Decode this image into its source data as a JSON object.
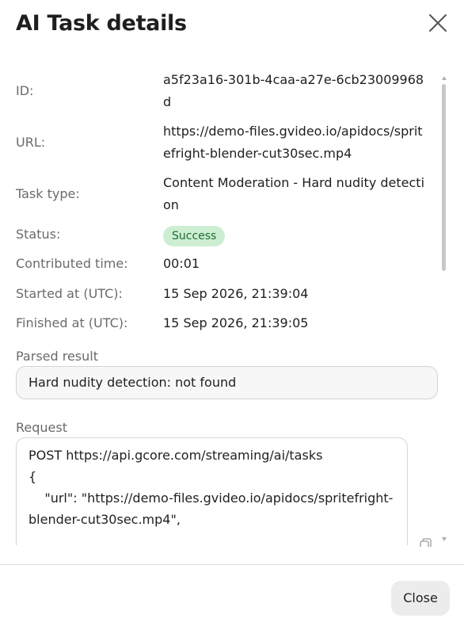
{
  "dialog": {
    "title": "AI Task details"
  },
  "details": {
    "id_label": "ID:",
    "id_value": "a5f23a16-301b-4caa-a27e-6cb23009968d",
    "url_label": "URL:",
    "url_value": "https://demo-files.gvideo.io/apidocs/spritefright-blender-cut30sec.mp4",
    "task_type_label": "Task type:",
    "task_type_value": "Content Moderation - Hard nudity detection",
    "status_label": "Status:",
    "status_value": "Success",
    "contributed_time_label": "Contributed time:",
    "contributed_time_value": "00:01",
    "started_label": "Started at (UTC):",
    "started_value": "15 Sep 2026, 21:39:04",
    "finished_label": "Finished at (UTC):",
    "finished_value": "15 Sep 2026, 21:39:05"
  },
  "parsed_result": {
    "label": "Parsed result",
    "value": "Hard nudity detection: not found"
  },
  "request": {
    "label": "Request",
    "lines": [
      "POST https://api.gcore.com/streaming/ai/tasks",
      "{",
      "    \"url\": \"https://demo-files.gvideo.io/apidocs/spritefright-blender-cut30sec.mp4\","
    ]
  },
  "footer": {
    "close_label": "Close"
  },
  "colors": {
    "success_badge_bg": "#cdeed3",
    "success_badge_text": "#1d6b32"
  },
  "icons": {
    "dialog_close": "close-icon",
    "copy": "copy-icon"
  }
}
